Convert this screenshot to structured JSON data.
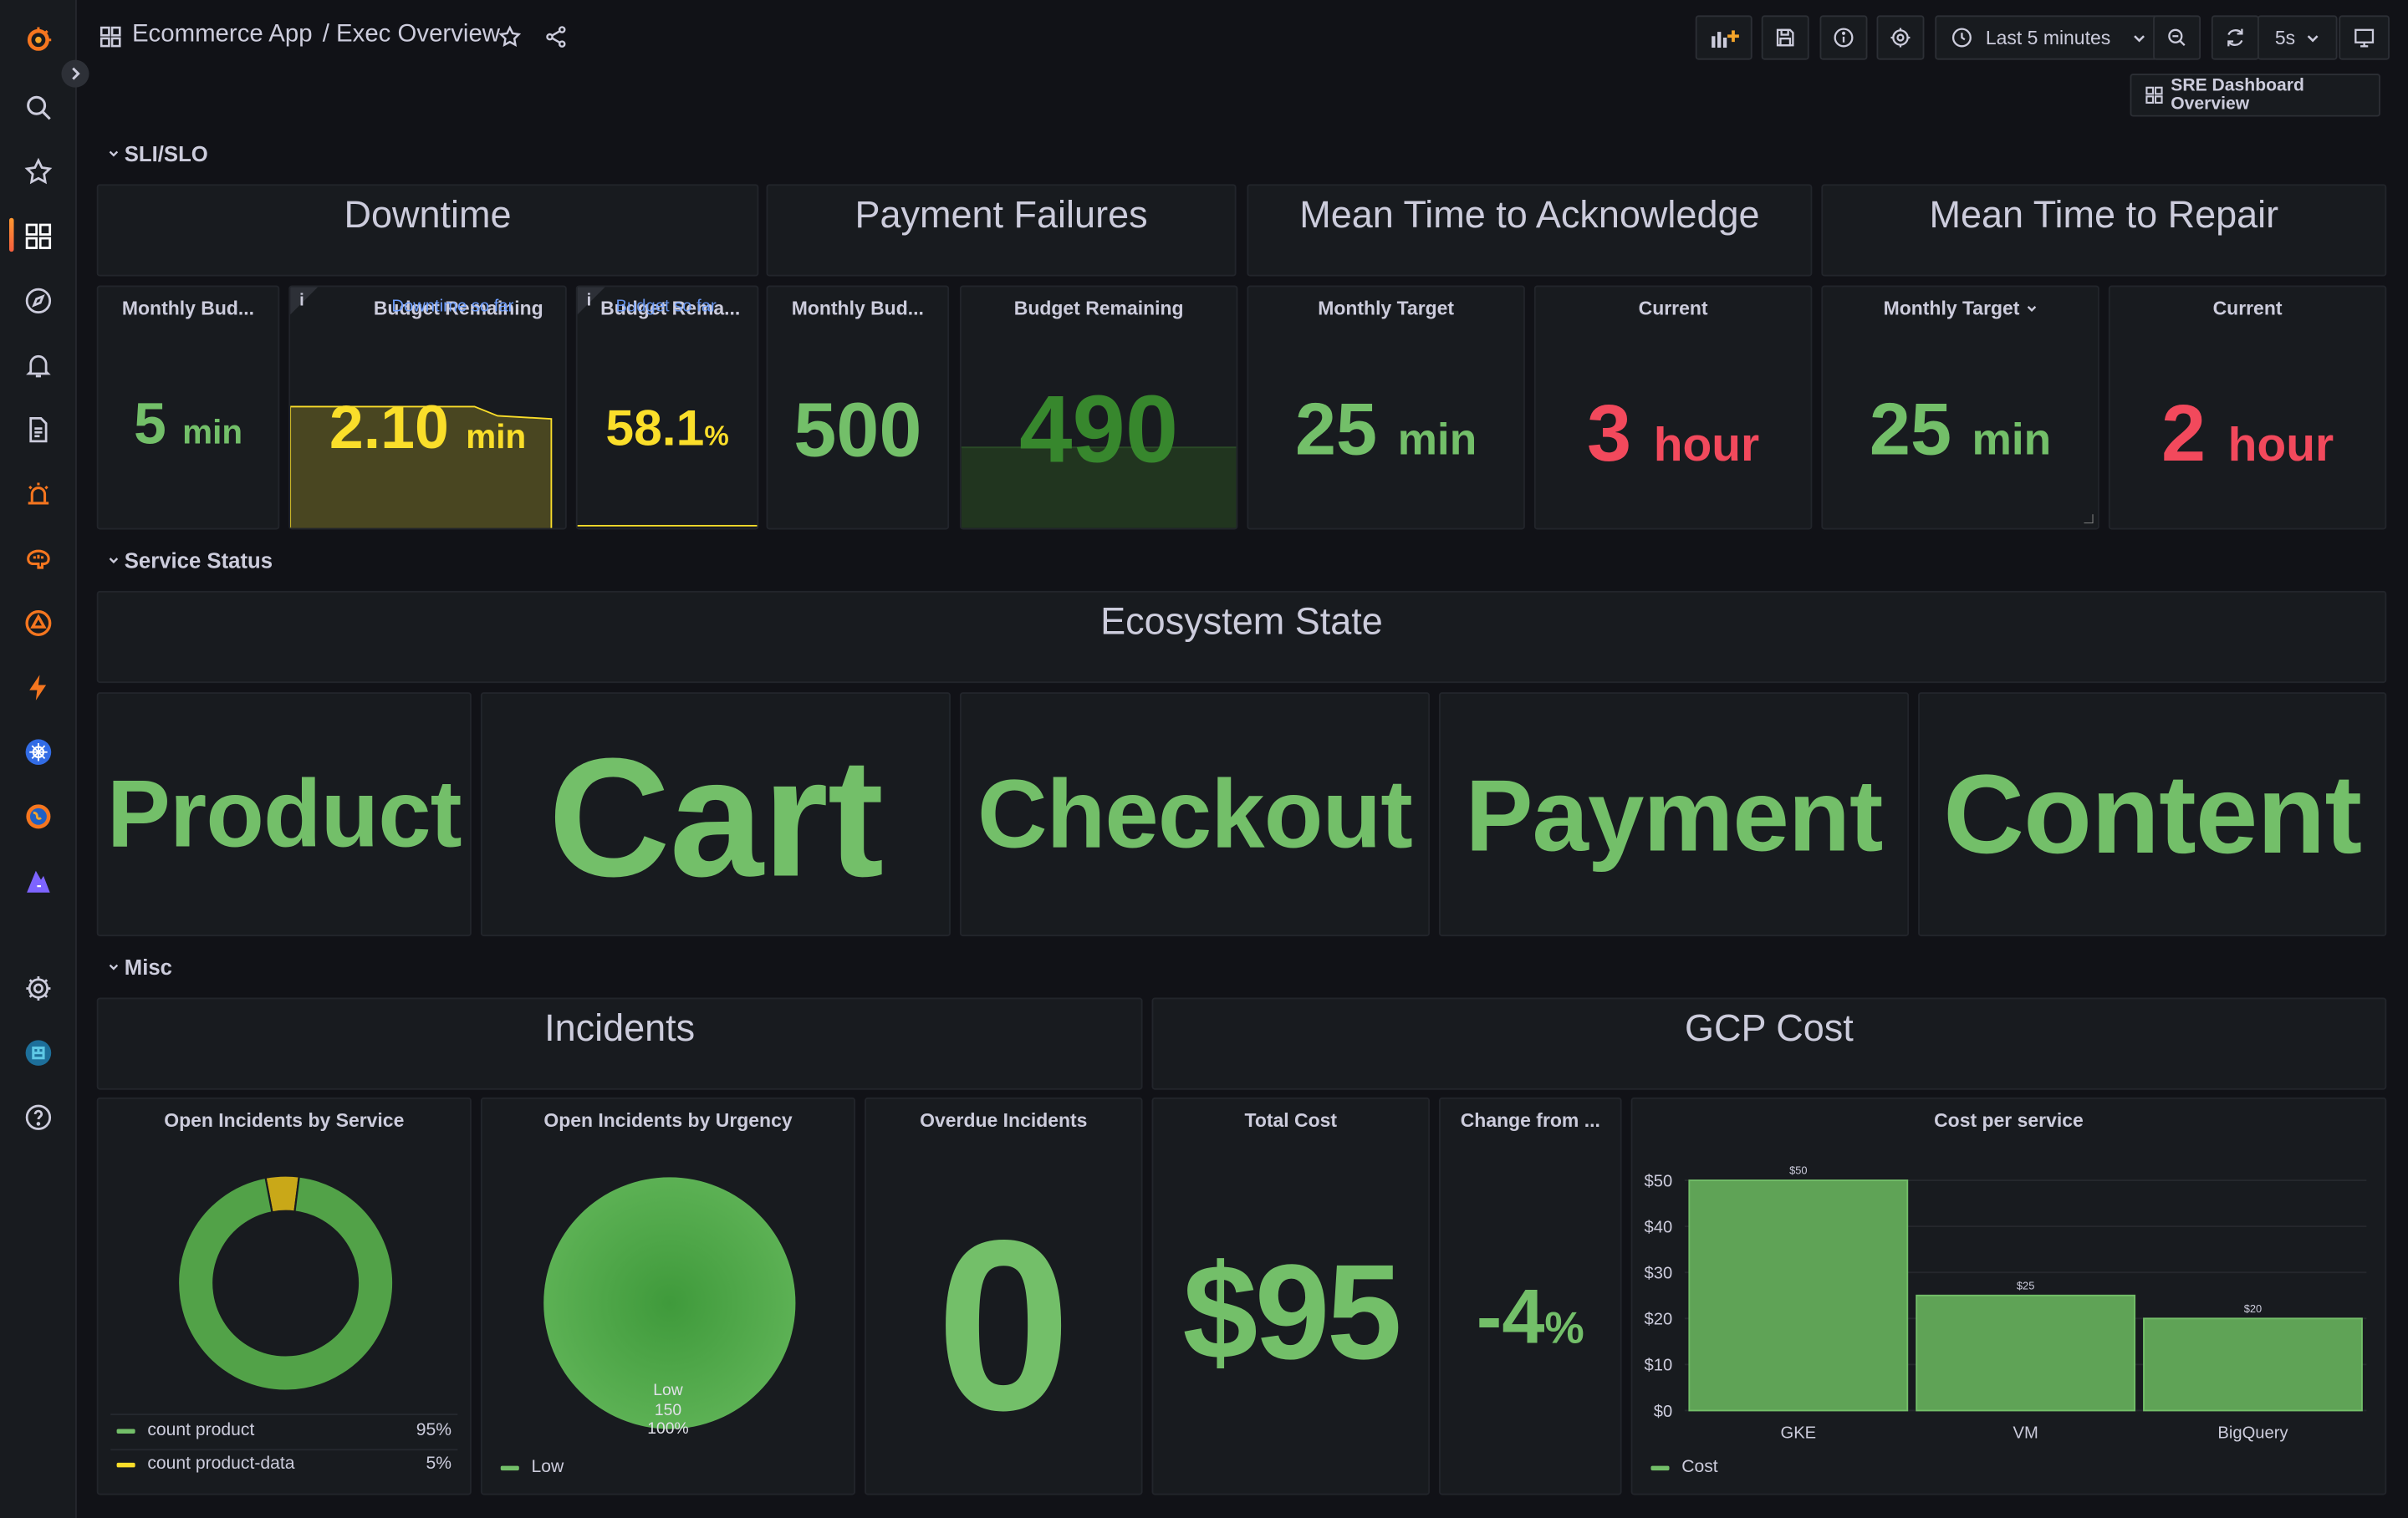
{
  "header": {
    "app": "Ecommerce App",
    "dashboard": "/ Exec Overview",
    "time_range": "Last 5 minutes",
    "refresh": "5s",
    "sre_link": "SRE Dashboard Overview"
  },
  "sidebar": {
    "icons": [
      "grafana-logo",
      "search-icon",
      "star-icon",
      "dashboards-icon",
      "explore-icon",
      "alerting-bell-icon",
      "reports-icon",
      "oncall-icon",
      "ml-brain-icon",
      "incident-icon",
      "k6-lightning-icon",
      "kubernetes-icon",
      "synthetic-globe-icon",
      "k6-icon",
      "gear-icon",
      "user-avatar",
      "help-icon"
    ]
  },
  "rows": {
    "sli": "SLI/SLO",
    "service": "Service Status",
    "misc": "Misc"
  },
  "sli": {
    "headers": [
      "Downtime",
      "Payment Failures",
      "Mean Time to Acknowledge",
      "Mean Time to Repair"
    ],
    "p1": {
      "title": "Monthly Bud...",
      "value": "5",
      "unit": "min"
    },
    "p2": {
      "title": "Budget Remaining",
      "overlay": "Downtime so far",
      "value": "2.10",
      "unit": "min",
      "fill_fraction": 0.51
    },
    "p3": {
      "title": "Budget Rema...",
      "overlay": "Budget so far",
      "value": "58.1",
      "unit": "%"
    },
    "p4": {
      "title": "Monthly Bud...",
      "value": "500"
    },
    "p5": {
      "title": "Budget Remaining",
      "value": "490",
      "fill_fraction": 0.34
    },
    "p6": {
      "title": "Monthly Target",
      "value": "25",
      "unit": "min"
    },
    "p7": {
      "title": "Current",
      "value": "3",
      "unit": "hour"
    },
    "p8": {
      "title": "Monthly Target",
      "value": "25",
      "unit": "min"
    },
    "p9": {
      "title": "Current",
      "value": "2",
      "unit": "hour"
    }
  },
  "service": {
    "header": "Ecosystem State",
    "services": [
      "Product",
      "Cart",
      "Checkout",
      "Payment",
      "Content"
    ]
  },
  "misc": {
    "incidents_header": "Incidents",
    "gcp_header": "GCP Cost",
    "donut": {
      "title": "Open Incidents by Service",
      "legend": [
        {
          "name": "count product",
          "pct": "95%",
          "color": "#73bf69"
        },
        {
          "name": "count product-data",
          "pct": "5%",
          "color": "#fade2a"
        }
      ],
      "fractions": [
        0.95,
        0.05
      ]
    },
    "pie": {
      "title": "Open Incidents by Urgency",
      "label_name": "Low",
      "label_count": "150",
      "label_pct": "100%",
      "legend": "Low"
    },
    "overdue": {
      "title": "Overdue Incidents",
      "value": "0"
    },
    "total_cost": {
      "title": "Total Cost",
      "value": "$95"
    },
    "change": {
      "title": "Change from ...",
      "value": "-4",
      "unit": "%"
    },
    "cost_chart_title": "Cost per service"
  },
  "chart_data": {
    "type": "bar",
    "title": "Cost per service",
    "categories": [
      "GKE",
      "VM",
      "BigQuery"
    ],
    "series": [
      {
        "name": "Cost",
        "values": [
          50,
          25,
          20
        ]
      }
    ],
    "data_labels": [
      "$50",
      "$25",
      "$20"
    ],
    "y_ticks": [
      "$0",
      "$10",
      "$20",
      "$30",
      "$40",
      "$50"
    ],
    "ylim": [
      0,
      50
    ],
    "legend": "bottom-left",
    "color": "#73bf69"
  }
}
